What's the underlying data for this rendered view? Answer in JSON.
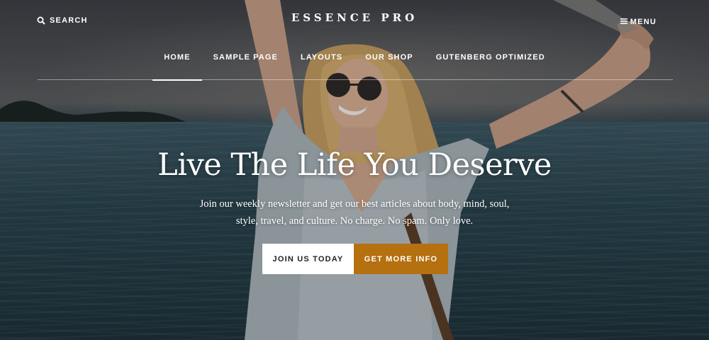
{
  "header": {
    "search_label": "SEARCH",
    "brand": "ESSENCE PRO",
    "menu_label": "MENU"
  },
  "nav": {
    "items": [
      {
        "label": "HOME",
        "active": true
      },
      {
        "label": "SAMPLE PAGE",
        "active": false
      },
      {
        "label": "LAYOUTS",
        "active": false
      },
      {
        "label": "OUR SHOP",
        "active": false
      },
      {
        "label": "GUTENBERG OPTIMIZED",
        "active": false
      }
    ]
  },
  "hero": {
    "headline": "Live The Life You Deserve",
    "subtext_line1": "Join our weekly newsletter and get our best articles about body, mind, soul,",
    "subtext_line2": "style, travel, and culture. No charge. No spam. Only love.",
    "primary_button": "JOIN US TODAY",
    "secondary_button": "GET MORE INFO"
  },
  "colors": {
    "accent": "#b5700f",
    "text_on_image": "#ffffff"
  },
  "icons": {
    "search": "search-icon",
    "menu": "hamburger-icon"
  }
}
